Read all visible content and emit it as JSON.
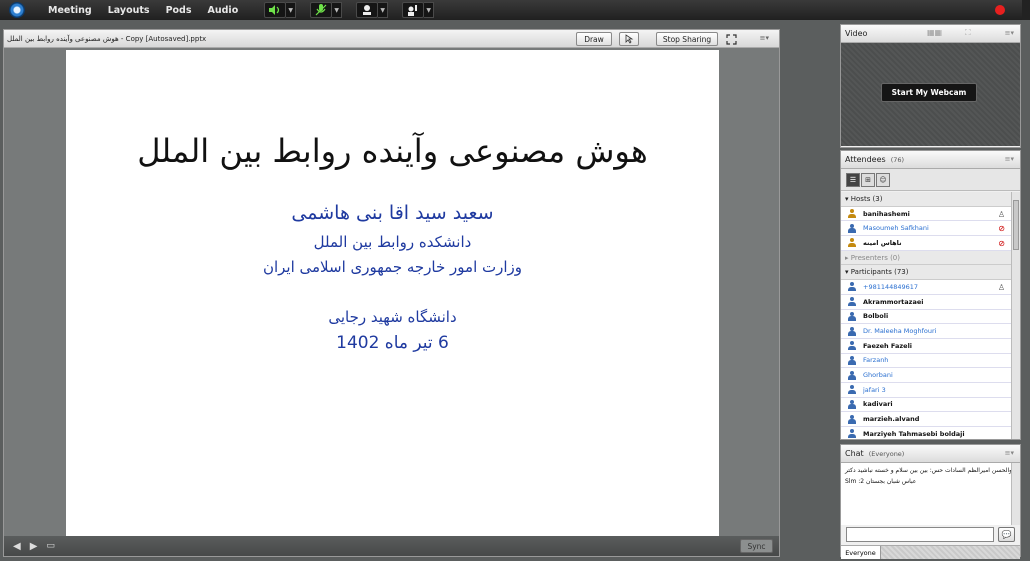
{
  "menubar": {
    "items": [
      "Meeting",
      "Layouts",
      "Pods",
      "Audio"
    ]
  },
  "share": {
    "title": "هوش مصنوعی وآینده روابط بین الملل - Copy [Autosaved].pptx",
    "draw_label": "Draw",
    "stop_sharing_label": "Stop Sharing",
    "sync_label": "Sync"
  },
  "slide": {
    "title": "هوش مصنوعی وآینده روابط بین الملل",
    "author": "سعید سید اقا بنی هاشمی",
    "faculty": "دانشکده روابط بین الملل",
    "ministry": "وزارت امور خارجه جمهوری اسلامی ایران",
    "university": "دانشگاه شهید رجایی",
    "date": "6 تیر ماه 1402"
  },
  "video": {
    "title": "Video",
    "webcam_label": "Start My Webcam"
  },
  "attendees": {
    "title": "Attendees",
    "count": "(76)",
    "hosts_label": "Hosts (3)",
    "presenters_label": "Presenters (0)",
    "participants_label": "Participants (73)",
    "hosts": [
      {
        "name": "banihashemi",
        "style": "dark",
        "icon": "gold-false",
        "status": "mic-icon"
      },
      {
        "name": "Masoumeh Safkhani",
        "style": "blue",
        "icon": "blue",
        "status": "mic-off-icon"
      },
      {
        "name": "ناهاس امینه",
        "style": "dark",
        "icon": "gold",
        "status": "mic-off-icon"
      }
    ],
    "participants": [
      {
        "name": "+981144849617",
        "style": "blue",
        "status": "mic-icon"
      },
      {
        "name": "Akrammortazaei",
        "style": "dark",
        "status": ""
      },
      {
        "name": "Bolboli",
        "style": "dark",
        "status": ""
      },
      {
        "name": "Dr. Maleeha Moghfouri",
        "style": "blue",
        "status": ""
      },
      {
        "name": "Faezeh Fazeli",
        "style": "dark",
        "status": ""
      },
      {
        "name": "Farzanh",
        "style": "blue",
        "status": ""
      },
      {
        "name": "Ghorbani",
        "style": "blue",
        "status": ""
      },
      {
        "name": "jafari 3",
        "style": "blue",
        "status": ""
      },
      {
        "name": "kadivari",
        "style": "dark",
        "status": ""
      },
      {
        "name": "marzieh.alvand",
        "style": "dark",
        "status": ""
      },
      {
        "name": "Marziyeh Tahmasebi boldaji",
        "style": "dark",
        "status": ""
      }
    ]
  },
  "chat": {
    "title": "Chat",
    "scope": "(Everyone)",
    "messages": [
      "ابوالحسن امیرالظم السادات حس: بین بین سلام و خسته نباشید دکتر",
      "عباس شبان بجستان 2: Slm"
    ],
    "tab_label": "Everyone"
  }
}
